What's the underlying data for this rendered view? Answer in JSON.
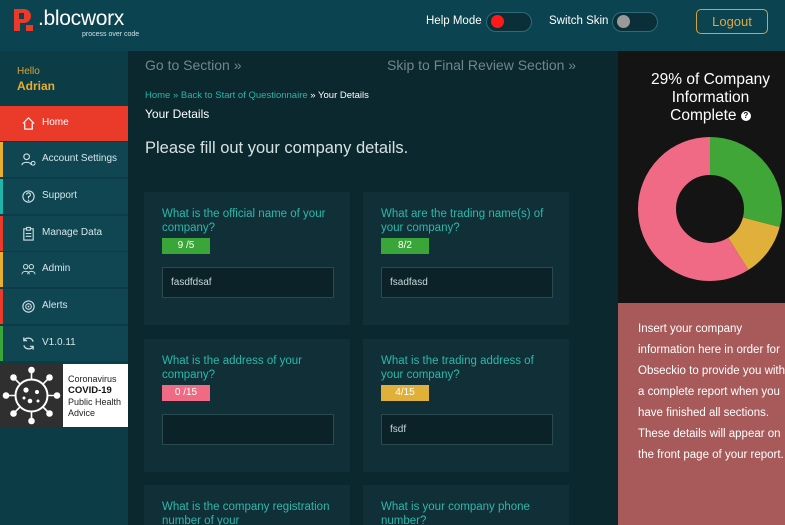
{
  "app": {
    "logo_text": ".blocworx",
    "tagline": "process over code"
  },
  "header": {
    "help_mode_label": "Help Mode",
    "help_mode_on": true,
    "switch_skin_label": "Switch Skin",
    "switch_skin_on": false,
    "logout_label": "Logout"
  },
  "user": {
    "greeting": "Hello",
    "name": "Adrian"
  },
  "sidebar": {
    "items": [
      {
        "label": "Home",
        "icon": "home-icon",
        "accent": "#e93a2a",
        "active": true
      },
      {
        "label": "Account Settings",
        "icon": "user-gear-icon",
        "accent": "#e8ae2d",
        "active": false
      },
      {
        "label": "Support",
        "icon": "support-icon",
        "accent": "#1fb5a8",
        "active": false
      },
      {
        "label": "Manage Data",
        "icon": "clipboard-icon",
        "accent": "#e93a2a",
        "active": false
      },
      {
        "label": "Admin",
        "icon": "admin-users-icon",
        "accent": "#e8ae2d",
        "active": false
      },
      {
        "label": "Alerts",
        "icon": "alerts-icon",
        "accent": "#e93a2a",
        "active": false
      },
      {
        "label": "V1.0.11",
        "icon": "refresh-icon",
        "accent": "#3aa63a",
        "active": false
      }
    ]
  },
  "covid": {
    "line1": "Coronavirus",
    "line2": "COVID-19",
    "line3": "Public Health",
    "line4": "Advice"
  },
  "main": {
    "go_to_section": "Go to Section »",
    "skip_section": "Skip to Final Review Section »",
    "breadcrumb": {
      "home": "Home",
      "sep1": " » ",
      "back": "Back to Start of Questionnaire",
      "sep2": " » ",
      "current": "Your Details"
    },
    "title": "Your Details",
    "intro": "Please fill out your company details.",
    "questions": [
      {
        "question": "What is the official name of your company?",
        "badge": "9 /5",
        "badge_color": "#3aa63a",
        "value": "fasdfdsaf"
      },
      {
        "question": "What are the trading name(s) of your company?",
        "badge": "8/2",
        "badge_color": "#3aa63a",
        "value": "fsadfasd"
      },
      {
        "question": "What is the address of your company?",
        "badge": "0 /15",
        "badge_color": "#ef6b84",
        "value": ""
      },
      {
        "question": "What is the trading address of your company?",
        "badge": "4/15",
        "badge_color": "#e0b03a",
        "value": "fsdf"
      },
      {
        "question": "What is the company registration number of your",
        "badge": "",
        "badge_color": "",
        "value": ""
      },
      {
        "question": "What is your company phone number?",
        "badge": "",
        "badge_color": "",
        "value": ""
      }
    ]
  },
  "progress": {
    "line1": "29% of Company",
    "line2": "Information",
    "line3": "Complete",
    "help_glyph": "?",
    "segments": [
      {
        "value": 29,
        "color": "#3fa637"
      },
      {
        "value": 12,
        "color": "#e0b03a"
      },
      {
        "value": 59,
        "color": "#f06a86"
      }
    ]
  },
  "info": {
    "text": "Insert your company information here in order for Obseckio to provide you with a complete report when you have finished all sections. These details will appear on the front page of your report."
  }
}
